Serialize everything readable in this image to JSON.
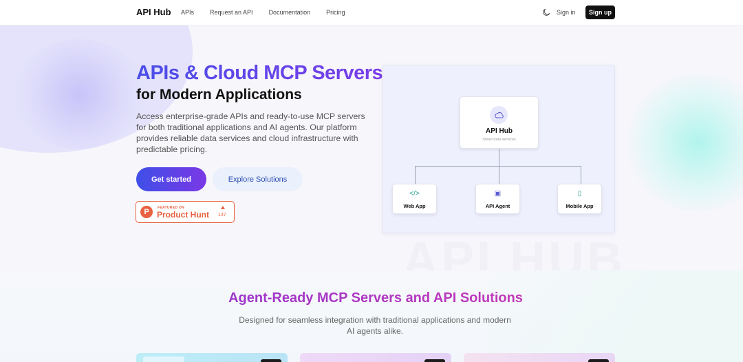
{
  "nav": {
    "brand": "API Hub",
    "links": [
      "APIs",
      "Request an API",
      "Documentation",
      "Pricing"
    ],
    "theme_icon": "moon-icon",
    "signin": "Sign in",
    "signup": "Sign up"
  },
  "hero": {
    "title": "APIs & Cloud MCP Servers",
    "subtitle": "for Modern Applications",
    "description": "Access enterprise-grade APIs and ready-to-use MCP servers for both traditional applications and AI agents. Our platform provides reliable data services and cloud infrastructure with predictable pricing.",
    "primary_cta": "Get started",
    "secondary_cta": "Explore Solutions",
    "product_hunt": {
      "featured_on": "FEATURED ON",
      "name": "Product Hunt",
      "votes": "137"
    },
    "watermark": "API HUB"
  },
  "diagram": {
    "hub": {
      "icon": "cloud-icon",
      "title": "API Hub",
      "subtitle": "Smart data services"
    },
    "nodes": [
      {
        "icon": "code-icon",
        "glyph": "</>",
        "label": "Web App"
      },
      {
        "icon": "chip-icon",
        "glyph": "▣",
        "label": "API Agent"
      },
      {
        "icon": "mobile-icon",
        "glyph": "▯",
        "label": "Mobile App"
      }
    ],
    "colors": {
      "accent": "#2aa38f",
      "line": "#9aa0b3"
    }
  },
  "section2": {
    "title": "Agent-Ready MCP Servers and API Solutions",
    "description": "Designed for seamless integration with traditional applications and modern AI agents alike."
  }
}
